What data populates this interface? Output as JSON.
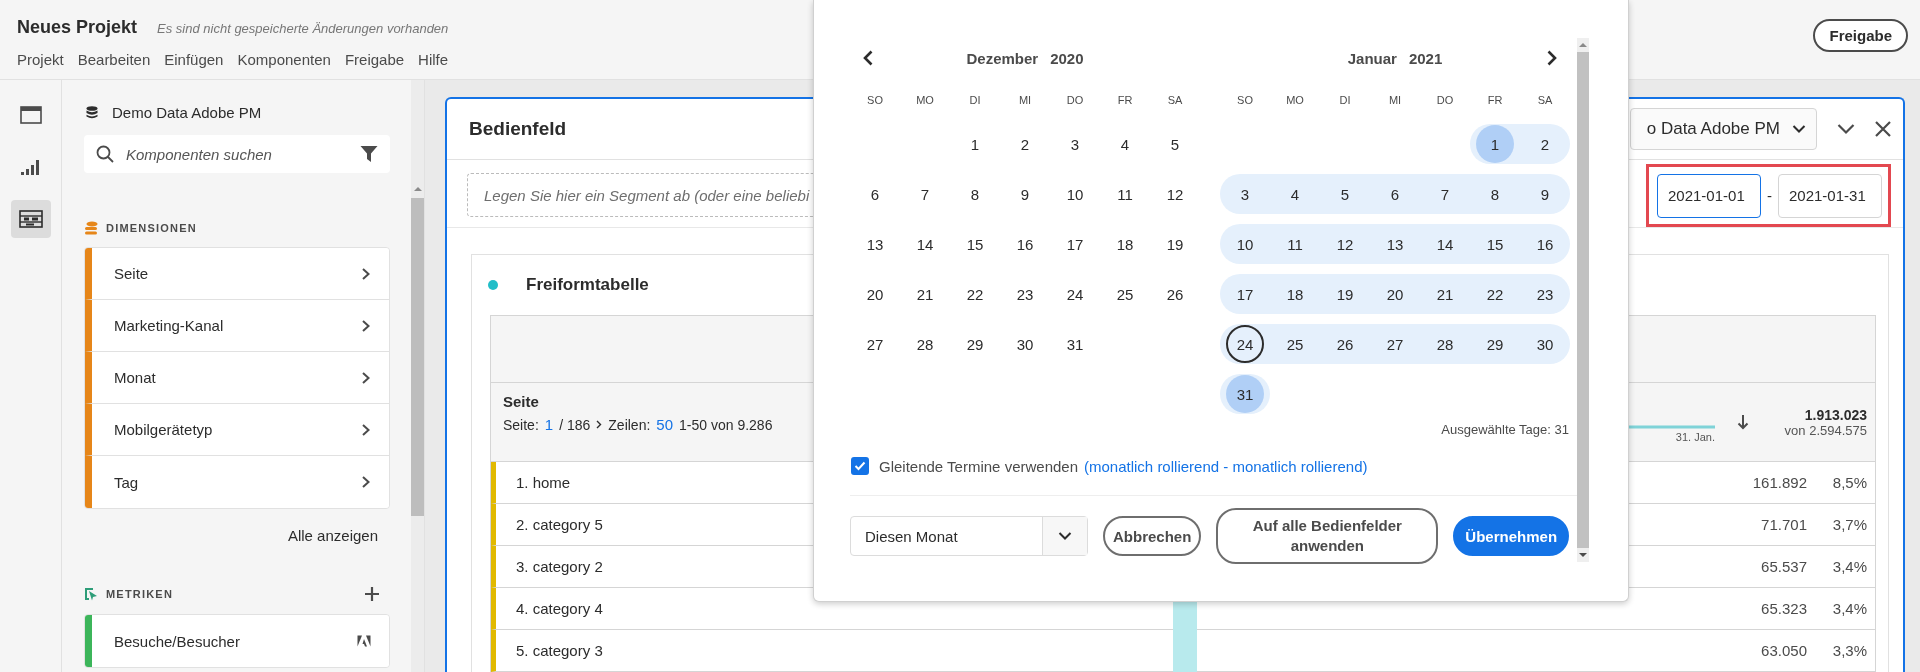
{
  "header": {
    "title": "Neues Projekt",
    "status": "Es sind nicht gespeicherte Änderungen vorhanden",
    "menu": [
      "Projekt",
      "Bearbeiten",
      "Einfügen",
      "Komponenten",
      "Freigabe",
      "Hilfe"
    ],
    "share_button": "Freigabe"
  },
  "rail": [
    {
      "kind": "panel",
      "selected": false
    },
    {
      "kind": "visualizations",
      "selected": false
    },
    {
      "kind": "components",
      "selected": true
    }
  ],
  "components": {
    "report_suite": "Demo Data Adobe PM",
    "search": {
      "placeholder": "Komponenten suchen"
    },
    "dimensions": {
      "title": "DIMENSIONEN",
      "items": [
        "Seite",
        "Marketing-Kanal",
        "Monat",
        "Mobilgerätetyp",
        "Tag"
      ],
      "show_all": "Alle anzeigen"
    },
    "metrics": {
      "title": "METRIKEN",
      "items": [
        "Besuche/Besucher"
      ]
    }
  },
  "panel": {
    "title": "Bedienfeld",
    "segment_drop": "Legen Sie hier ein Segment ab (oder eine beliebi",
    "report_suite": "o Data Adobe PM",
    "date_start": "2021-01-01",
    "date_separator": "-",
    "date_end": "2021-01-31",
    "table": {
      "title": "Freiformtabelle",
      "dimension": "Seite",
      "pagination": {
        "page_label": "Seite:",
        "page": "1",
        "pages": "/ 186",
        "rows_label": "Zeilen:",
        "rows": "50",
        "range": "1-50 von 9.286"
      },
      "metric": {
        "sparkline_label": "31. Jan.",
        "total": "1.913.023",
        "of_total": "von 2.594.575"
      },
      "rows": [
        {
          "label": "1. home",
          "value": "161.892",
          "percent": "8,5%"
        },
        {
          "label": "2. category 5",
          "value": "71.701",
          "percent": "3,7%"
        },
        {
          "label": "3. category 2",
          "value": "65.537",
          "percent": "3,4%"
        },
        {
          "label": "4. category 4",
          "value": "65.323",
          "percent": "3,4%"
        },
        {
          "label": "5. category 3",
          "value": "63.050",
          "percent": "3,3%"
        }
      ]
    }
  },
  "calendar": {
    "months": [
      {
        "name": "Dezember",
        "year": "2020",
        "weekdays": [
          "SO",
          "MO",
          "DI",
          "MI",
          "DO",
          "FR",
          "SA"
        ],
        "weeks": [
          [
            {
              "kind": "empty"
            },
            {
              "kind": "empty"
            },
            {
              "kind": "day",
              "day": "1",
              "in_range": false,
              "selected": false,
              "today": false
            },
            {
              "kind": "day",
              "day": "2",
              "in_range": false,
              "selected": false,
              "today": false
            },
            {
              "kind": "day",
              "day": "3",
              "in_range": false,
              "selected": false,
              "today": false
            },
            {
              "kind": "day",
              "day": "4",
              "in_range": false,
              "selected": false,
              "today": false
            },
            {
              "kind": "day",
              "day": "5",
              "in_range": false,
              "selected": false,
              "today": false
            }
          ],
          [
            {
              "kind": "day",
              "day": "6",
              "in_range": false,
              "selected": false,
              "today": false
            },
            {
              "kind": "day",
              "day": "7",
              "in_range": false,
              "selected": false,
              "today": false
            },
            {
              "kind": "day",
              "day": "8",
              "in_range": false,
              "selected": false,
              "today": false
            },
            {
              "kind": "day",
              "day": "9",
              "in_range": false,
              "selected": false,
              "today": false
            },
            {
              "kind": "day",
              "day": "10",
              "in_range": false,
              "selected": false,
              "today": false
            },
            {
              "kind": "day",
              "day": "11",
              "in_range": false,
              "selected": false,
              "today": false
            },
            {
              "kind": "day",
              "day": "12",
              "in_range": false,
              "selected": false,
              "today": false
            }
          ],
          [
            {
              "kind": "day",
              "day": "13",
              "in_range": false,
              "selected": false,
              "today": false
            },
            {
              "kind": "day",
              "day": "14",
              "in_range": false,
              "selected": false,
              "today": false
            },
            {
              "kind": "day",
              "day": "15",
              "in_range": false,
              "selected": false,
              "today": false
            },
            {
              "kind": "day",
              "day": "16",
              "in_range": false,
              "selected": false,
              "today": false
            },
            {
              "kind": "day",
              "day": "17",
              "in_range": false,
              "selected": false,
              "today": false
            },
            {
              "kind": "day",
              "day": "18",
              "in_range": false,
              "selected": false,
              "today": false
            },
            {
              "kind": "day",
              "day": "19",
              "in_range": false,
              "selected": false,
              "today": false
            }
          ],
          [
            {
              "kind": "day",
              "day": "20",
              "in_range": false,
              "selected": false,
              "today": false
            },
            {
              "kind": "day",
              "day": "21",
              "in_range": false,
              "selected": false,
              "today": false
            },
            {
              "kind": "day",
              "day": "22",
              "in_range": false,
              "selected": false,
              "today": false
            },
            {
              "kind": "day",
              "day": "23",
              "in_range": false,
              "selected": false,
              "today": false
            },
            {
              "kind": "day",
              "day": "24",
              "in_range": false,
              "selected": false,
              "today": false
            },
            {
              "kind": "day",
              "day": "25",
              "in_range": false,
              "selected": false,
              "today": false
            },
            {
              "kind": "day",
              "day": "26",
              "in_range": false,
              "selected": false,
              "today": false
            }
          ],
          [
            {
              "kind": "day",
              "day": "27",
              "in_range": false,
              "selected": false,
              "today": false
            },
            {
              "kind": "day",
              "day": "28",
              "in_range": false,
              "selected": false,
              "today": false
            },
            {
              "kind": "day",
              "day": "29",
              "in_range": false,
              "selected": false,
              "today": false
            },
            {
              "kind": "day",
              "day": "30",
              "in_range": false,
              "selected": false,
              "today": false
            },
            {
              "kind": "day",
              "day": "31",
              "in_range": false,
              "selected": false,
              "today": false
            }
          ]
        ]
      },
      {
        "name": "Januar",
        "year": "2021",
        "weekdays": [
          "SO",
          "MO",
          "DI",
          "MI",
          "DO",
          "FR",
          "SA"
        ],
        "weeks": [
          [
            {
              "kind": "empty"
            },
            {
              "kind": "empty"
            },
            {
              "kind": "empty"
            },
            {
              "kind": "empty"
            },
            {
              "kind": "empty"
            },
            {
              "kind": "day",
              "day": "1",
              "in_range": true,
              "selected": true,
              "today": false
            },
            {
              "kind": "day",
              "day": "2",
              "in_range": true,
              "selected": false,
              "today": false
            }
          ],
          [
            {
              "kind": "day",
              "day": "3",
              "in_range": true,
              "selected": false,
              "today": false
            },
            {
              "kind": "day",
              "day": "4",
              "in_range": true,
              "selected": false,
              "today": false
            },
            {
              "kind": "day",
              "day": "5",
              "in_range": true,
              "selected": false,
              "today": false
            },
            {
              "kind": "day",
              "day": "6",
              "in_range": true,
              "selected": false,
              "today": false
            },
            {
              "kind": "day",
              "day": "7",
              "in_range": true,
              "selected": false,
              "today": false
            },
            {
              "kind": "day",
              "day": "8",
              "in_range": true,
              "selected": false,
              "today": false
            },
            {
              "kind": "day",
              "day": "9",
              "in_range": true,
              "selected": false,
              "today": false
            }
          ],
          [
            {
              "kind": "day",
              "day": "10",
              "in_range": true,
              "selected": false,
              "today": false
            },
            {
              "kind": "day",
              "day": "11",
              "in_range": true,
              "selected": false,
              "today": false
            },
            {
              "kind": "day",
              "day": "12",
              "in_range": true,
              "selected": false,
              "today": false
            },
            {
              "kind": "day",
              "day": "13",
              "in_range": true,
              "selected": false,
              "today": false
            },
            {
              "kind": "day",
              "day": "14",
              "in_range": true,
              "selected": false,
              "today": false
            },
            {
              "kind": "day",
              "day": "15",
              "in_range": true,
              "selected": false,
              "today": false
            },
            {
              "kind": "day",
              "day": "16",
              "in_range": true,
              "selected": false,
              "today": false
            }
          ],
          [
            {
              "kind": "day",
              "day": "17",
              "in_range": true,
              "selected": false,
              "today": false
            },
            {
              "kind": "day",
              "day": "18",
              "in_range": true,
              "selected": false,
              "today": false
            },
            {
              "kind": "day",
              "day": "19",
              "in_range": true,
              "selected": false,
              "today": false
            },
            {
              "kind": "day",
              "day": "20",
              "in_range": true,
              "selected": false,
              "today": false
            },
            {
              "kind": "day",
              "day": "21",
              "in_range": true,
              "selected": false,
              "today": false
            },
            {
              "kind": "day",
              "day": "22",
              "in_range": true,
              "selected": false,
              "today": false
            },
            {
              "kind": "day",
              "day": "23",
              "in_range": true,
              "selected": false,
              "today": false
            }
          ],
          [
            {
              "kind": "day",
              "day": "24",
              "in_range": true,
              "selected": false,
              "today": true
            },
            {
              "kind": "day",
              "day": "25",
              "in_range": true,
              "selected": false,
              "today": false
            },
            {
              "kind": "day",
              "day": "26",
              "in_range": true,
              "selected": false,
              "today": false
            },
            {
              "kind": "day",
              "day": "27",
              "in_range": true,
              "selected": false,
              "today": false
            },
            {
              "kind": "day",
              "day": "28",
              "in_range": true,
              "selected": false,
              "today": false
            },
            {
              "kind": "day",
              "day": "29",
              "in_range": true,
              "selected": false,
              "today": false
            },
            {
              "kind": "day",
              "day": "30",
              "in_range": true,
              "selected": false,
              "today": false
            }
          ],
          [
            {
              "kind": "day",
              "day": "31",
              "in_range": true,
              "selected": true,
              "today": false
            }
          ]
        ]
      }
    ],
    "selected_days": "Ausgewählte Tage: 31",
    "rolling": {
      "checked": true,
      "label": "Gleitende Termine verwenden",
      "link": "(monatlich rollierend - monatlich rollierend)"
    },
    "preset": "Diesen Monat",
    "buttons": {
      "cancel": "Abbrechen",
      "apply_all": "Auf alle Bedienfelder anwenden",
      "apply": "Übernehmen"
    }
  }
}
